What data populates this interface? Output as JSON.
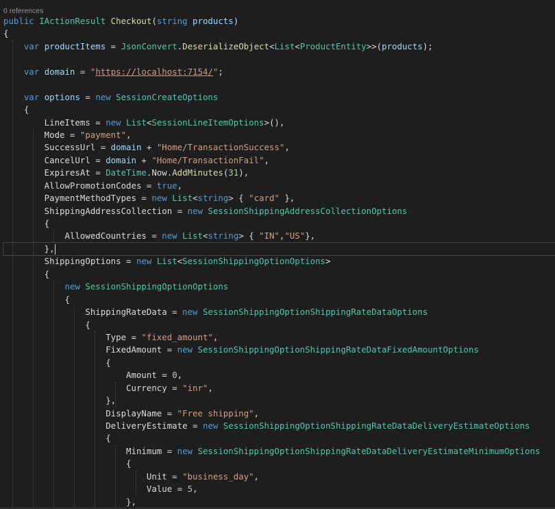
{
  "editor": {
    "codelens": "0 references",
    "lines": [
      [
        [
          "kw",
          "public "
        ],
        [
          "typ",
          "IActionResult "
        ],
        [
          "mth",
          "Checkout"
        ],
        [
          "pl",
          "("
        ],
        [
          "kw",
          "string "
        ],
        [
          "var",
          "products"
        ],
        [
          "pl",
          ")"
        ]
      ],
      [
        [
          "pl",
          "{"
        ]
      ],
      [
        [
          "pl",
          "    "
        ],
        [
          "kw",
          "var "
        ],
        [
          "var",
          "productItems"
        ],
        [
          "pl",
          " = "
        ],
        [
          "typ",
          "JsonConvert"
        ],
        [
          "pl",
          "."
        ],
        [
          "mth",
          "DeserializeObject"
        ],
        [
          "pl",
          "<"
        ],
        [
          "typ",
          "List"
        ],
        [
          "pl",
          "<"
        ],
        [
          "typ",
          "ProductEntity"
        ],
        [
          "pl",
          ">>("
        ],
        [
          "var",
          "products"
        ],
        [
          "pl",
          ");"
        ]
      ],
      [],
      [
        [
          "pl",
          "    "
        ],
        [
          "kw",
          "var "
        ],
        [
          "var",
          "domain"
        ],
        [
          "pl",
          " = "
        ],
        [
          "str",
          "\""
        ],
        [
          "url",
          "https://localhost:7154/"
        ],
        [
          "str",
          "\""
        ],
        [
          "pl",
          ";"
        ]
      ],
      [],
      [
        [
          "pl",
          "    "
        ],
        [
          "kw",
          "var "
        ],
        [
          "var",
          "options"
        ],
        [
          "pl",
          " = "
        ],
        [
          "kw",
          "new "
        ],
        [
          "typ",
          "SessionCreateOptions"
        ]
      ],
      [
        [
          "pl",
          "    {"
        ]
      ],
      [
        [
          "pl",
          "        LineItems = "
        ],
        [
          "kw",
          "new "
        ],
        [
          "typ",
          "List"
        ],
        [
          "pl",
          "<"
        ],
        [
          "typ",
          "SessionLineItemOptions"
        ],
        [
          "pl",
          ">(),"
        ]
      ],
      [
        [
          "pl",
          "        Mode = "
        ],
        [
          "str",
          "\"payment\""
        ],
        [
          "pl",
          ","
        ]
      ],
      [
        [
          "pl",
          "        SuccessUrl = "
        ],
        [
          "var",
          "domain"
        ],
        [
          "pl",
          " + "
        ],
        [
          "str",
          "\"Home/TransactionSuccess\""
        ],
        [
          "pl",
          ","
        ]
      ],
      [
        [
          "pl",
          "        CancelUrl = "
        ],
        [
          "var",
          "domain"
        ],
        [
          "pl",
          " + "
        ],
        [
          "str",
          "\"Home/TransactionFail\""
        ],
        [
          "pl",
          ","
        ]
      ],
      [
        [
          "pl",
          "        ExpiresAt = "
        ],
        [
          "typ",
          "DateTime"
        ],
        [
          "pl",
          ".Now."
        ],
        [
          "mth",
          "AddMinutes"
        ],
        [
          "pl",
          "("
        ],
        [
          "num",
          "31"
        ],
        [
          "pl",
          "),"
        ]
      ],
      [
        [
          "pl",
          "        AllowPromotionCodes = "
        ],
        [
          "kw",
          "true"
        ],
        [
          "pl",
          ","
        ]
      ],
      [
        [
          "pl",
          "        PaymentMethodTypes = "
        ],
        [
          "kw",
          "new "
        ],
        [
          "typ",
          "List"
        ],
        [
          "pl",
          "<"
        ],
        [
          "kw",
          "string"
        ],
        [
          "pl",
          "> { "
        ],
        [
          "str",
          "\"card\""
        ],
        [
          "pl",
          " },"
        ]
      ],
      [
        [
          "pl",
          "        ShippingAddressCollection = "
        ],
        [
          "kw",
          "new "
        ],
        [
          "typ",
          "SessionShippingAddressCollectionOptions"
        ]
      ],
      [
        [
          "pl",
          "        {"
        ]
      ],
      [
        [
          "pl",
          "            AllowedCountries = "
        ],
        [
          "kw",
          "new "
        ],
        [
          "typ",
          "List"
        ],
        [
          "pl",
          "<"
        ],
        [
          "kw",
          "string"
        ],
        [
          "pl",
          "> { "
        ],
        [
          "str",
          "\"IN\""
        ],
        [
          "pl",
          ","
        ],
        [
          "str",
          "\"US\""
        ],
        [
          "pl",
          "},"
        ]
      ],
      [
        [
          "pl",
          "        },"
        ]
      ],
      [
        [
          "pl",
          "        ShippingOptions = "
        ],
        [
          "kw",
          "new "
        ],
        [
          "typ",
          "List"
        ],
        [
          "pl",
          "<"
        ],
        [
          "typ",
          "SessionShippingOptionOptions"
        ],
        [
          "pl",
          ">"
        ]
      ],
      [
        [
          "pl",
          "        {"
        ]
      ],
      [
        [
          "pl",
          "            "
        ],
        [
          "kw",
          "new "
        ],
        [
          "typ",
          "SessionShippingOptionOptions"
        ]
      ],
      [
        [
          "pl",
          "            {"
        ]
      ],
      [
        [
          "pl",
          "                ShippingRateData = "
        ],
        [
          "kw",
          "new "
        ],
        [
          "typ",
          "SessionShippingOptionShippingRateDataOptions"
        ]
      ],
      [
        [
          "pl",
          "                {"
        ]
      ],
      [
        [
          "pl",
          "                    Type = "
        ],
        [
          "str",
          "\"fixed_amount\""
        ],
        [
          "pl",
          ","
        ]
      ],
      [
        [
          "pl",
          "                    FixedAmount = "
        ],
        [
          "kw",
          "new "
        ],
        [
          "typ",
          "SessionShippingOptionShippingRateDataFixedAmountOptions"
        ]
      ],
      [
        [
          "pl",
          "                    {"
        ]
      ],
      [
        [
          "pl",
          "                        Amount = "
        ],
        [
          "num",
          "0"
        ],
        [
          "pl",
          ","
        ]
      ],
      [
        [
          "pl",
          "                        Currency = "
        ],
        [
          "str",
          "\"inr\""
        ],
        [
          "pl",
          ","
        ]
      ],
      [
        [
          "pl",
          "                    },"
        ]
      ],
      [
        [
          "pl",
          "                    DisplayName = "
        ],
        [
          "str",
          "\"Free shipping\""
        ],
        [
          "pl",
          ","
        ]
      ],
      [
        [
          "pl",
          "                    DeliveryEstimate = "
        ],
        [
          "kw",
          "new "
        ],
        [
          "typ",
          "SessionShippingOptionShippingRateDataDeliveryEstimateOptions"
        ]
      ],
      [
        [
          "pl",
          "                    {"
        ]
      ],
      [
        [
          "pl",
          "                        Minimum = "
        ],
        [
          "kw",
          "new "
        ],
        [
          "typ",
          "SessionShippingOptionShippingRateDataDeliveryEstimateMinimumOptions"
        ]
      ],
      [
        [
          "pl",
          "                        {"
        ]
      ],
      [
        [
          "pl",
          "                            Unit = "
        ],
        [
          "str",
          "\"business_day\""
        ],
        [
          "pl",
          ","
        ]
      ],
      [
        [
          "pl",
          "                            Value = "
        ],
        [
          "num",
          "5"
        ],
        [
          "pl",
          ","
        ]
      ],
      [
        [
          "pl",
          "                        },"
        ]
      ]
    ],
    "current_line": 18,
    "colors": {
      "background": "#1e1e1e",
      "keyword": "#569cd6",
      "type": "#4ec9b0",
      "method": "#dcdcaa",
      "string": "#d69d85",
      "number": "#b5cea8",
      "variable": "#9cdcfe",
      "plain": "#dcdcdc"
    }
  }
}
